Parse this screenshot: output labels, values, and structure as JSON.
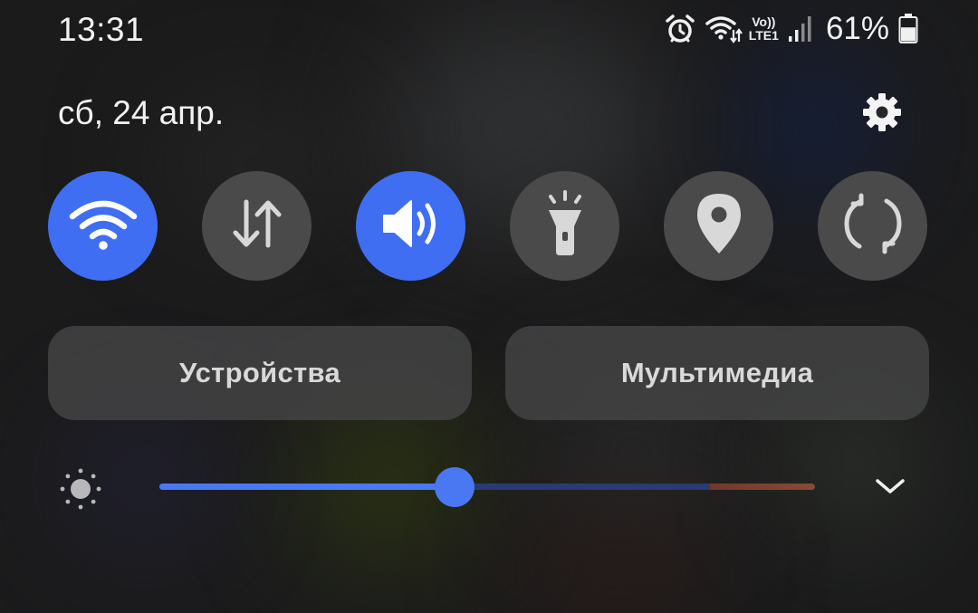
{
  "status_bar": {
    "time": "13:31",
    "icons": [
      "alarm-icon",
      "wifi-calling-icon",
      "volte-indicator",
      "signal-icon",
      "battery-icon"
    ],
    "volte_top": "Vo))",
    "volte_bottom": "LTE1",
    "battery_percent": "61%",
    "battery_level": 0.61
  },
  "header": {
    "date": "сб, 24 апр.",
    "settings_icon": "gear-icon"
  },
  "quick_tiles": [
    {
      "icon": "wifi-icon",
      "active": true
    },
    {
      "icon": "mobile-data-icon",
      "active": false
    },
    {
      "icon": "sound-icon",
      "active": true
    },
    {
      "icon": "flashlight-icon",
      "active": false
    },
    {
      "icon": "location-icon",
      "active": false
    },
    {
      "icon": "auto-rotate-icon",
      "active": false
    }
  ],
  "buttons": {
    "devices": "Устройства",
    "media": "Мультимедиа"
  },
  "brightness": {
    "icon": "sun-icon",
    "level": 0.45,
    "expand_icon": "chevron-down-icon"
  },
  "colors": {
    "accent": "#3f6ef2",
    "tile_inactive": "#4a4a4b",
    "background": "#1b1b1c"
  }
}
